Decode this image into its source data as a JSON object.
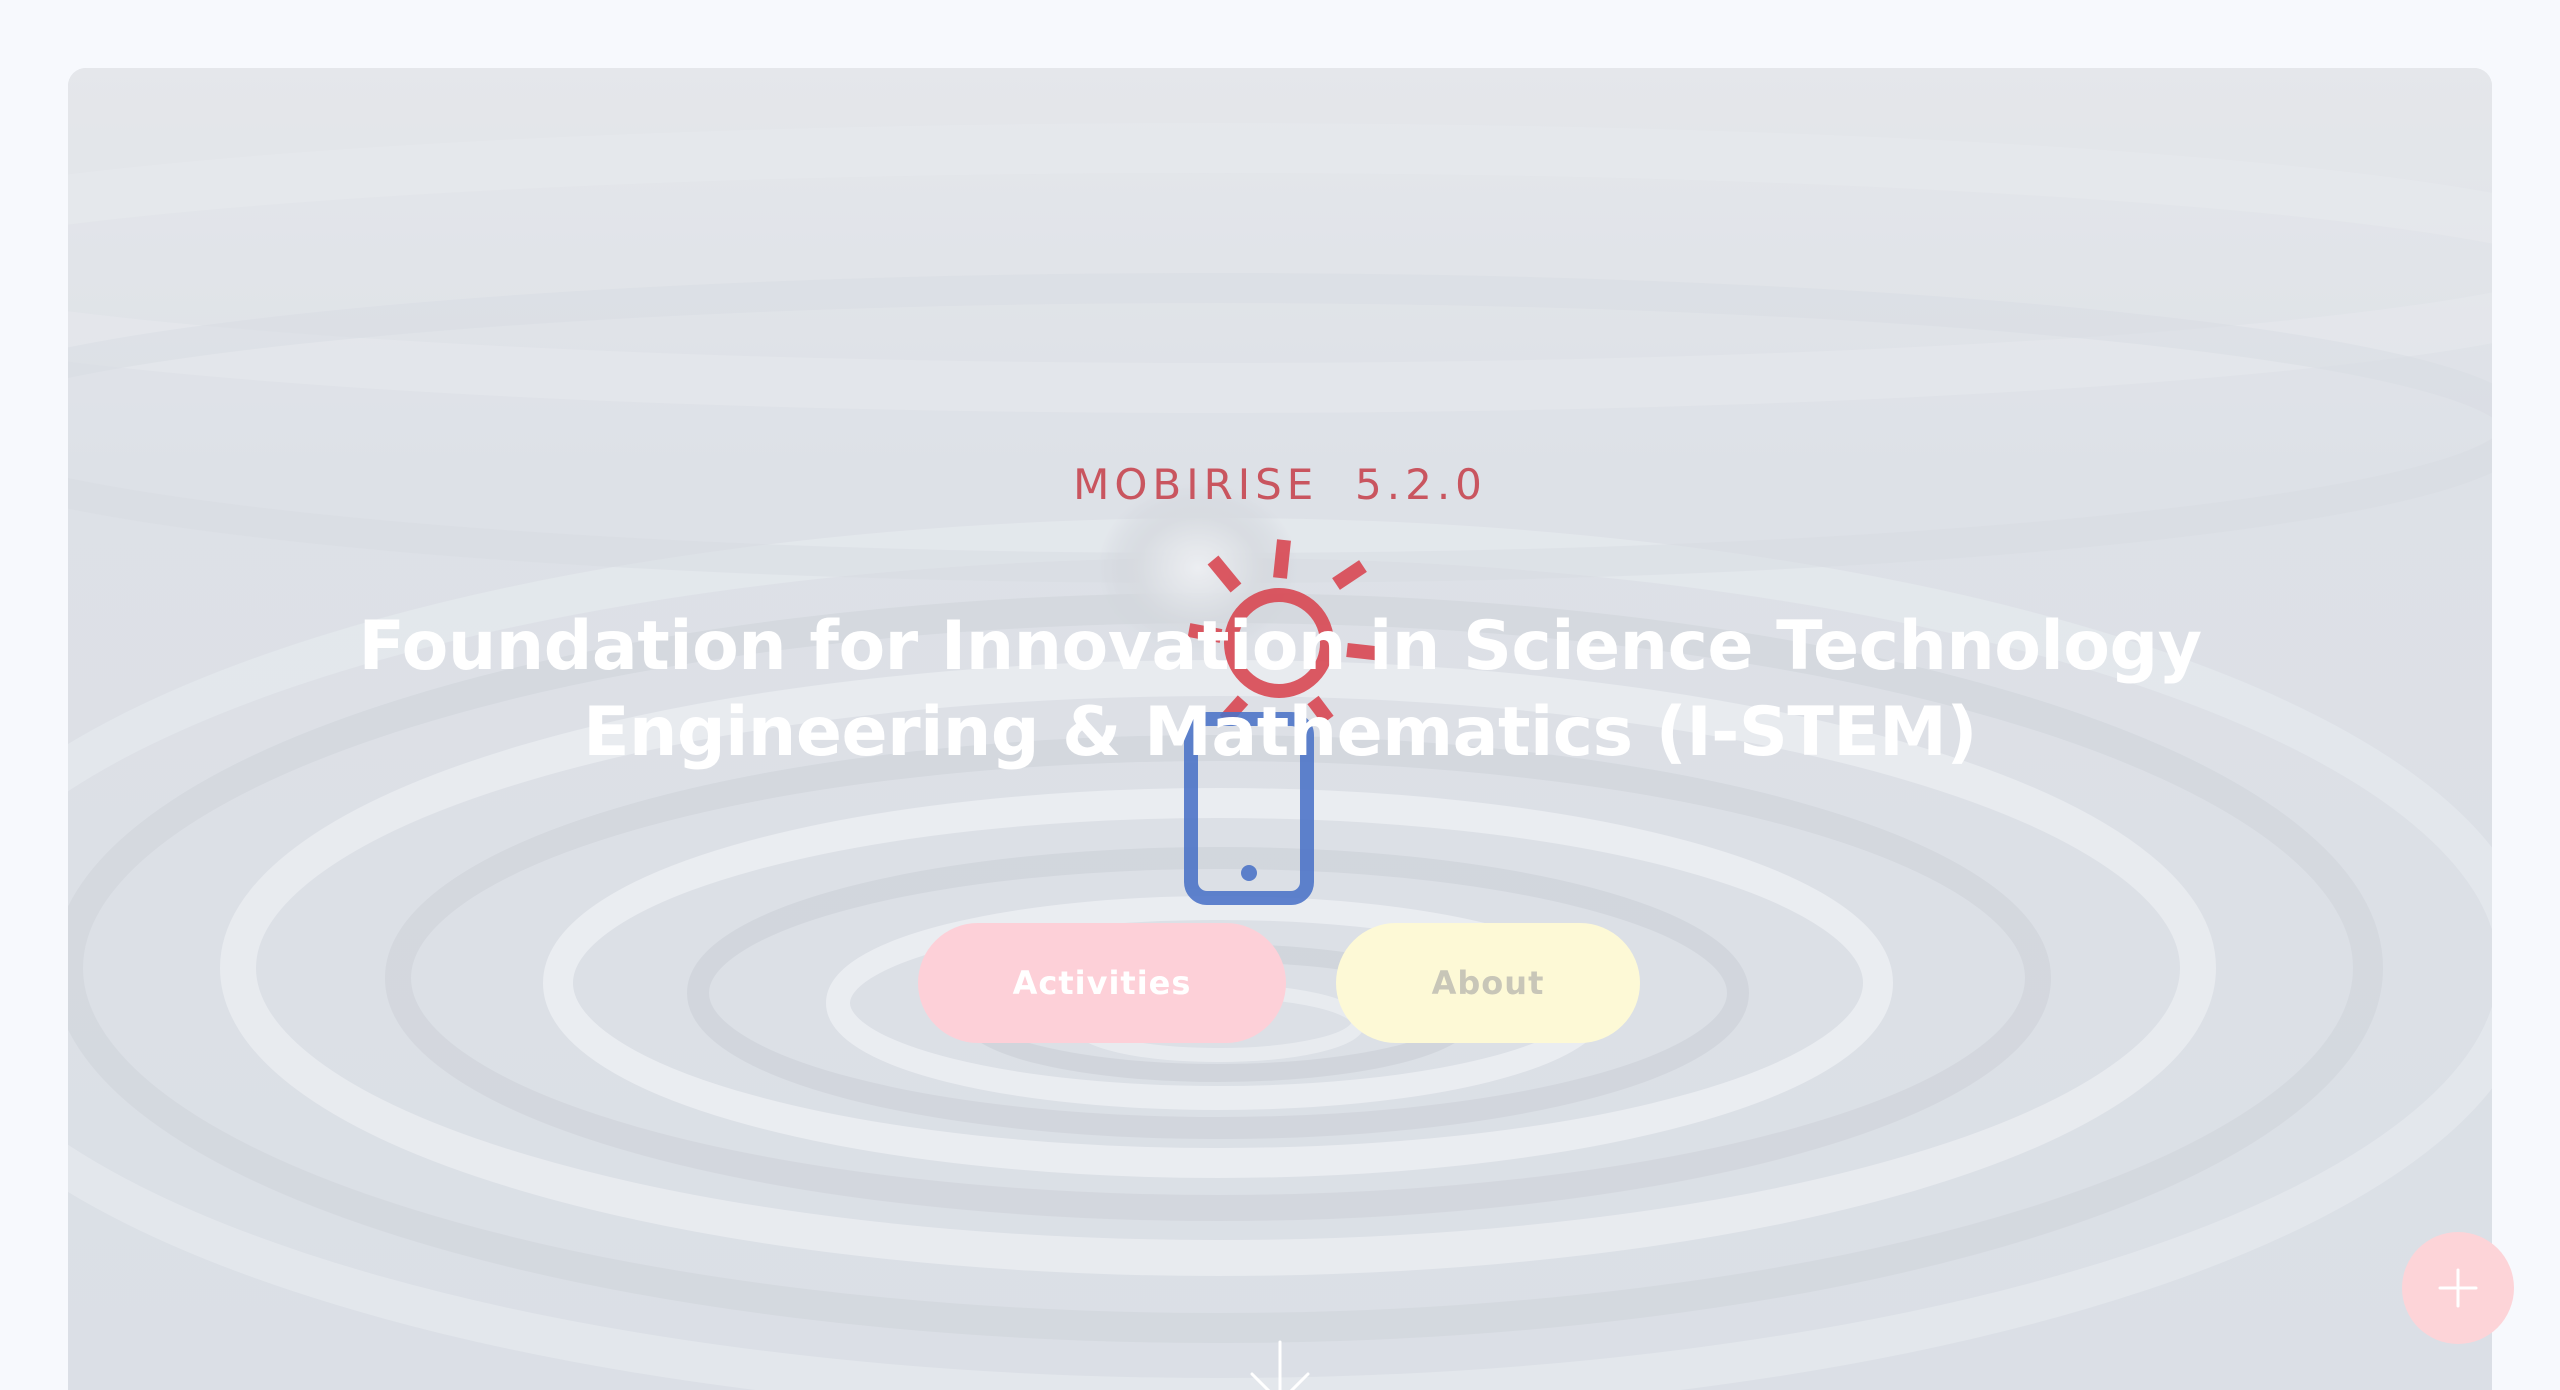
{
  "hero": {
    "kicker": "MOBIRISE  5.2.0",
    "title_line1": "Foundation for Innovation in Science Technology",
    "title_line2": "Engineering & Mathematics (I-STEM)",
    "background_icon": "water-ripple-image"
  },
  "buttons": {
    "activities_label": "Activities",
    "about_label": "About"
  },
  "icons": {
    "loader_sun": "sun-icon",
    "loader_phone": "mobile-phone-icon",
    "scroll_down": "arrow-down-icon",
    "fab": "plus-icon"
  },
  "colors": {
    "page_background": "#f7f9fd",
    "kicker": "#c9555f",
    "sun_icon": "#d9444f",
    "phone_icon": "#4a72c7",
    "activities_button": "#fdd0d8",
    "about_button": "#fdf9d6",
    "fab": "#fdd4d8"
  }
}
